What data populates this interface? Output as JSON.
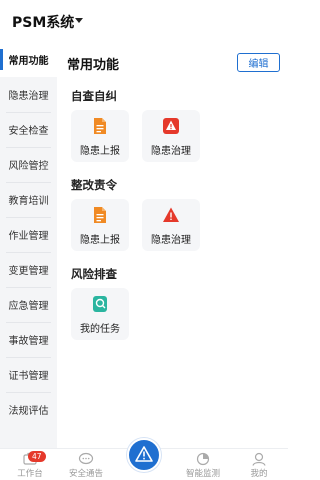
{
  "header": {
    "title": "PSM系统"
  },
  "sidebar": {
    "items": [
      {
        "label": "常用功能"
      },
      {
        "label": "隐患治理"
      },
      {
        "label": "安全检查"
      },
      {
        "label": "风险管控"
      },
      {
        "label": "教育培训"
      },
      {
        "label": "作业管理"
      },
      {
        "label": "变更管理"
      },
      {
        "label": "应急管理"
      },
      {
        "label": "事故管理"
      },
      {
        "label": "证书管理"
      },
      {
        "label": "法规评估"
      }
    ]
  },
  "main": {
    "title": "常用功能",
    "edit_label": "编辑",
    "sections": [
      {
        "title": "自查自纠",
        "tiles": [
          {
            "label": "隐患上报",
            "icon": "report-document-icon"
          },
          {
            "label": "隐患治理",
            "icon": "warning-icon"
          }
        ]
      },
      {
        "title": "整改责令",
        "tiles": [
          {
            "label": "隐患上报",
            "icon": "report-document-icon"
          },
          {
            "label": "隐患治理",
            "icon": "warning-icon"
          }
        ]
      },
      {
        "title": "风险排查",
        "tiles": [
          {
            "label": "我的任务",
            "icon": "task-icon"
          }
        ]
      }
    ]
  },
  "tabbar": {
    "items": [
      {
        "label": "工作台",
        "icon": "workbench-icon",
        "badge": "47"
      },
      {
        "label": "安全通告",
        "icon": "chat-bubble-icon"
      },
      {
        "label": "",
        "icon": "warning-triangle-icon"
      },
      {
        "label": "智能监测",
        "icon": "pie-chart-icon"
      },
      {
        "label": "我的",
        "icon": "profile-icon"
      }
    ]
  },
  "colors": {
    "accent": "#1f6fd0",
    "report_icon": "#f08a24",
    "warning_icon": "#e5392b",
    "task_icon": "#2bb5a0",
    "badge": "#e5392b"
  }
}
